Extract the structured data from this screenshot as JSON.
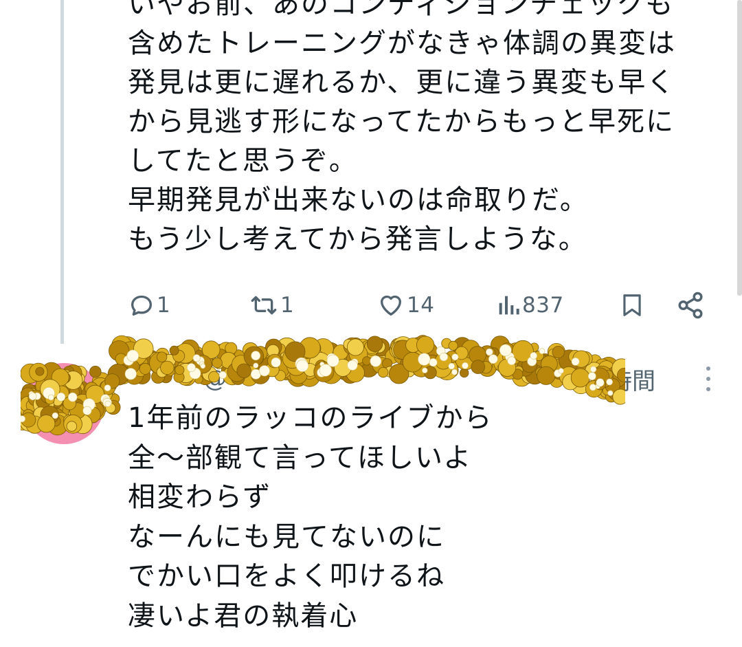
{
  "post1": {
    "text_lines": [
      "いやお前、あのコンディションチェックも",
      "含めたトレーニングがなきゃ体調の異変は",
      "発見は更に遅れるか、更に違う異変も早く",
      "から見逃す形になってたからもっと早死に",
      "してたと思うぞ。",
      "早期発見が出来ないのは命取りだ。",
      "もう少し考えてから発言しような。"
    ],
    "actions": {
      "reply_count": "1",
      "retweet_count": "1",
      "like_count": "14",
      "views_count": "837"
    }
  },
  "post2": {
    "display_name": "",
    "handle": "@",
    "timestamp": "時間",
    "text_lines": [
      "1年前のラッコのライブから",
      "全〜部観て言ってほしいよ",
      "相変わらず",
      "なーんにも見てないのに",
      "でかい口をよく叩けるね",
      "凄いよ君の執着心"
    ]
  },
  "colors": {
    "text": "#0f1419",
    "secondary": "#536471",
    "thread_line": "#cfd9de",
    "avatar_bg": "#f48fb1",
    "glitter_gold": "#d4a017"
  },
  "icons": {
    "reply": "reply-icon",
    "retweet": "retweet-icon",
    "like": "heart-icon",
    "views": "views-icon",
    "bookmark": "bookmark-icon",
    "share": "share-icon",
    "more": "more-icon"
  }
}
